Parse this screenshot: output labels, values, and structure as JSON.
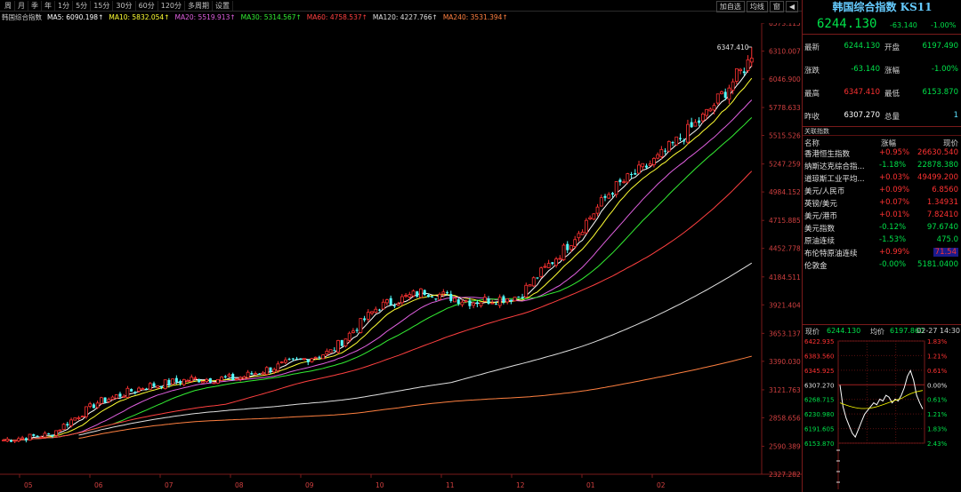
{
  "toolbar": {
    "period_tabs": [
      "周",
      "月",
      "季",
      "年",
      "1分",
      "5分",
      "15分",
      "30分",
      "60分",
      "120分",
      "多周期",
      "设置"
    ],
    "right_buttons": [
      "加自选",
      "均线",
      "窗",
      "◀"
    ]
  },
  "ma_legend": [
    {
      "text": "韩国综合指数",
      "color": "#d0d0d0"
    },
    {
      "text": "MA5: 6090.198↑",
      "color": "#ffffff"
    },
    {
      "text": "MA10: 5832.054↑",
      "color": "#ffff33"
    },
    {
      "text": "MA20: 5519.913↑",
      "color": "#e060e0"
    },
    {
      "text": "MA30: 5314.567↑",
      "color": "#33ee33"
    },
    {
      "text": "MA60: 4758.537↑",
      "color": "#ff4040"
    },
    {
      "text": "MA120: 4227.766↑",
      "color": "#e0e0e0"
    },
    {
      "text": "MA240: 3531.394↑",
      "color": "#ff8040"
    }
  ],
  "chart_data": {
    "type": "candlestick",
    "title": "韩国综合指数",
    "y_ticks": [
      "6573.115",
      "6310.007",
      "6046.900",
      "5778.633",
      "5515.526",
      "5247.259",
      "4984.152",
      "4715.885",
      "4452.778",
      "4184.511",
      "3921.404",
      "3653.137",
      "3390.030",
      "3121.763",
      "2858.656",
      "2590.389",
      "2327.282"
    ],
    "ylim": [
      2327.282,
      6573.115
    ],
    "x_ticks": [
      "05",
      "06",
      "07",
      "08",
      "09",
      "10",
      "11",
      "12",
      "01",
      "02"
    ],
    "max_annotation": "6347.410",
    "candles_close": [
      2650,
      2700,
      3000,
      3150,
      3220,
      3230,
      3360,
      3480,
      3900,
      4050,
      3950,
      4000,
      4450,
      5000,
      5300,
      5700,
      6244
    ],
    "ma_series": [
      {
        "name": "MA5",
        "color": "#ffffff"
      },
      {
        "name": "MA10",
        "color": "#ffff33"
      },
      {
        "name": "MA20",
        "color": "#e060e0"
      },
      {
        "name": "MA30",
        "color": "#33ee33"
      },
      {
        "name": "MA60",
        "color": "#ff4040"
      },
      {
        "name": "MA120",
        "color": "#e0e0e0"
      },
      {
        "name": "MA240",
        "color": "#ff8040"
      }
    ]
  },
  "quote": {
    "title": "韩国综合指数 KS11",
    "last": "6244.130",
    "change": "-63.140",
    "pct": "-1.00%",
    "rows": [
      {
        "l1": "最新",
        "v1": "6244.130",
        "c1": "green",
        "l2": "开盘",
        "v2": "6197.490",
        "c2": "green"
      },
      {
        "l1": "涨跌",
        "v1": "-63.140",
        "c1": "green",
        "l2": "涨幅",
        "v2": "-1.00%",
        "c2": "green"
      },
      {
        "l1": "最高",
        "v1": "6347.410",
        "c1": "red",
        "l2": "最低",
        "v2": "6153.870",
        "c2": "green"
      },
      {
        "l1": "昨收",
        "v1": "6307.270",
        "c1": "white",
        "l2": "总量",
        "v2": "1",
        "c2": "cyan"
      }
    ]
  },
  "related": {
    "title": "关联指数",
    "headers": [
      "名称",
      "涨幅",
      "现价"
    ],
    "rows": [
      {
        "name": "香港恒生指数",
        "chg": "+0.95%",
        "price": "26630.540",
        "cc": "red",
        "pc": "red"
      },
      {
        "name": "纳斯达克综合指...",
        "chg": "-1.18%",
        "price": "22878.380",
        "cc": "green",
        "pc": "green"
      },
      {
        "name": "道琼斯工业平均...",
        "chg": "+0.03%",
        "price": "49499.200",
        "cc": "red",
        "pc": "red"
      },
      {
        "name": "美元/人民币",
        "chg": "+0.09%",
        "price": "6.8560",
        "cc": "red",
        "pc": "red"
      },
      {
        "name": "英镑/美元",
        "chg": "+0.07%",
        "price": "1.34931",
        "cc": "red",
        "pc": "red"
      },
      {
        "name": "美元/港币",
        "chg": "+0.01%",
        "price": "7.82410",
        "cc": "red",
        "pc": "red"
      },
      {
        "name": "美元指数",
        "chg": "-0.12%",
        "price": "97.6740",
        "cc": "green",
        "pc": "green"
      },
      {
        "name": "原油连续",
        "chg": "-1.53%",
        "price": "475.0",
        "cc": "green",
        "pc": "green"
      },
      {
        "name": "布伦特原油连续",
        "chg": "+0.99%",
        "price": "71.54",
        "cc": "red",
        "pc": "red"
      },
      {
        "name": "伦敦金",
        "chg": "-0.00%",
        "price": "5181.0400",
        "cc": "green",
        "pc": "green"
      }
    ]
  },
  "mini": {
    "label_now": "现价",
    "now": "6244.130",
    "label_avg": "均价",
    "avg": "6197.860",
    "time": "02-27 14:30",
    "left_ticks": [
      "6422.935",
      "6383.560",
      "6345.925",
      "6307.270",
      "6268.715",
      "6230.980",
      "6191.605",
      "6153.870"
    ],
    "right_ticks": [
      "1.83%",
      "1.21%",
      "0.61%",
      "0.00%",
      "0.61%",
      "1.21%",
      "1.83%",
      "2.43%"
    ]
  }
}
